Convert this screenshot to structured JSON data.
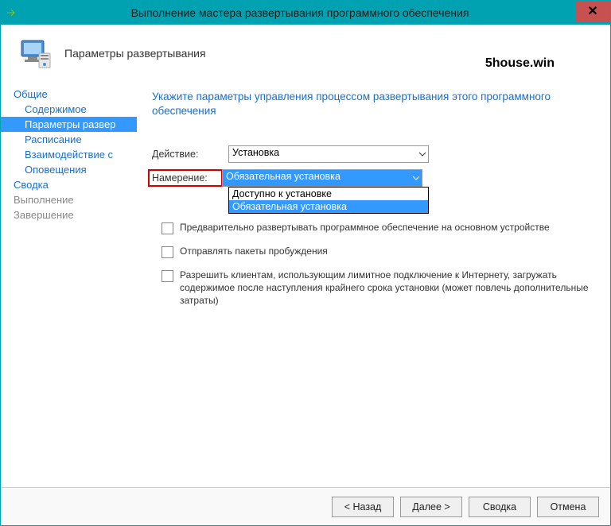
{
  "window": {
    "title": "Выполнение мастера развертывания программного обеспечения",
    "close_icon": "✕"
  },
  "header": {
    "title": "Параметры развертывания",
    "watermark": "5house.win"
  },
  "sidebar": {
    "items": [
      {
        "label": "Общие",
        "type": "top"
      },
      {
        "label": "Содержимое",
        "type": "child"
      },
      {
        "label": "Параметры развертывания",
        "type": "child",
        "active": true
      },
      {
        "label": "Расписание",
        "type": "child"
      },
      {
        "label": "Взаимодействие с пользователем",
        "type": "child"
      },
      {
        "label": "Оповещения",
        "type": "child"
      },
      {
        "label": "Сводка",
        "type": "top"
      },
      {
        "label": "Выполнение",
        "type": "top",
        "disabled": true
      },
      {
        "label": "Завершение",
        "type": "top",
        "disabled": true
      }
    ]
  },
  "content": {
    "title": "Укажите параметры управления процессом развертывания этого программного обеспечения",
    "action_label": "Действие:",
    "action_value": "Установка",
    "purpose_label": "Намерение:",
    "purpose_value": "Обязательная установка",
    "purpose_options": [
      "Доступно к установке",
      "Обязательная установка"
    ],
    "checkboxes": [
      "Предварительно развертывать программное обеспечение на основном устройстве",
      "Отправлять пакеты пробуждения",
      "Разрешить клиентам, использующим лимитное подключение к Интернету, загружать содержимое после наступления крайнего срока установки (может повлечь дополнительные затраты)"
    ]
  },
  "footer": {
    "back": "< Назад",
    "next": "Далее >",
    "summary": "Сводка",
    "cancel": "Отмена"
  }
}
